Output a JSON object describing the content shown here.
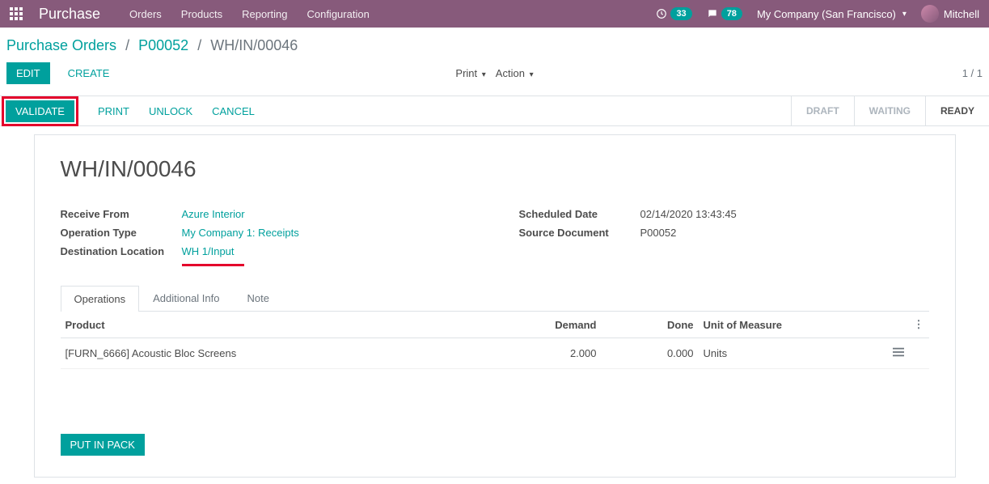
{
  "app": {
    "title": "Purchase"
  },
  "topnav": {
    "orders": "Orders",
    "products": "Products",
    "reporting": "Reporting",
    "config": "Configuration"
  },
  "topbar": {
    "activity_count": "33",
    "chat_count": "78",
    "company": "My Company (San Francisco)",
    "user": "Mitchell"
  },
  "breadcrumb": {
    "root": "Purchase Orders",
    "po": "P00052",
    "current": "WH/IN/00046"
  },
  "controls": {
    "edit": "EDIT",
    "create": "CREATE",
    "print": "Print",
    "action": "Action",
    "pager": "1 / 1"
  },
  "statusbar": {
    "validate": "VALIDATE",
    "print": "PRINT",
    "unlock": "UNLOCK",
    "cancel": "CANCEL",
    "stages": {
      "draft": "DRAFT",
      "waiting": "WAITING",
      "ready": "READY"
    }
  },
  "record": {
    "name": "WH/IN/00046",
    "receive_from_label": "Receive From",
    "receive_from": "Azure Interior",
    "operation_type_label": "Operation Type",
    "operation_type": "My Company 1: Receipts",
    "dest_loc_label": "Destination Location",
    "dest_loc": "WH 1/Input",
    "scheduled_date_label": "Scheduled Date",
    "scheduled_date": "02/14/2020 13:43:45",
    "source_doc_label": "Source Document",
    "source_doc": "P00052"
  },
  "tabs": {
    "operations": "Operations",
    "addl": "Additional Info",
    "note": "Note"
  },
  "table": {
    "headers": {
      "product": "Product",
      "demand": "Demand",
      "done": "Done",
      "uom": "Unit of Measure"
    },
    "rows": [
      {
        "product": "[FURN_6666] Acoustic Bloc Screens",
        "demand": "2.000",
        "done": "0.000",
        "uom": "Units"
      }
    ]
  },
  "buttons": {
    "put_in_pack": "PUT IN PACK"
  }
}
